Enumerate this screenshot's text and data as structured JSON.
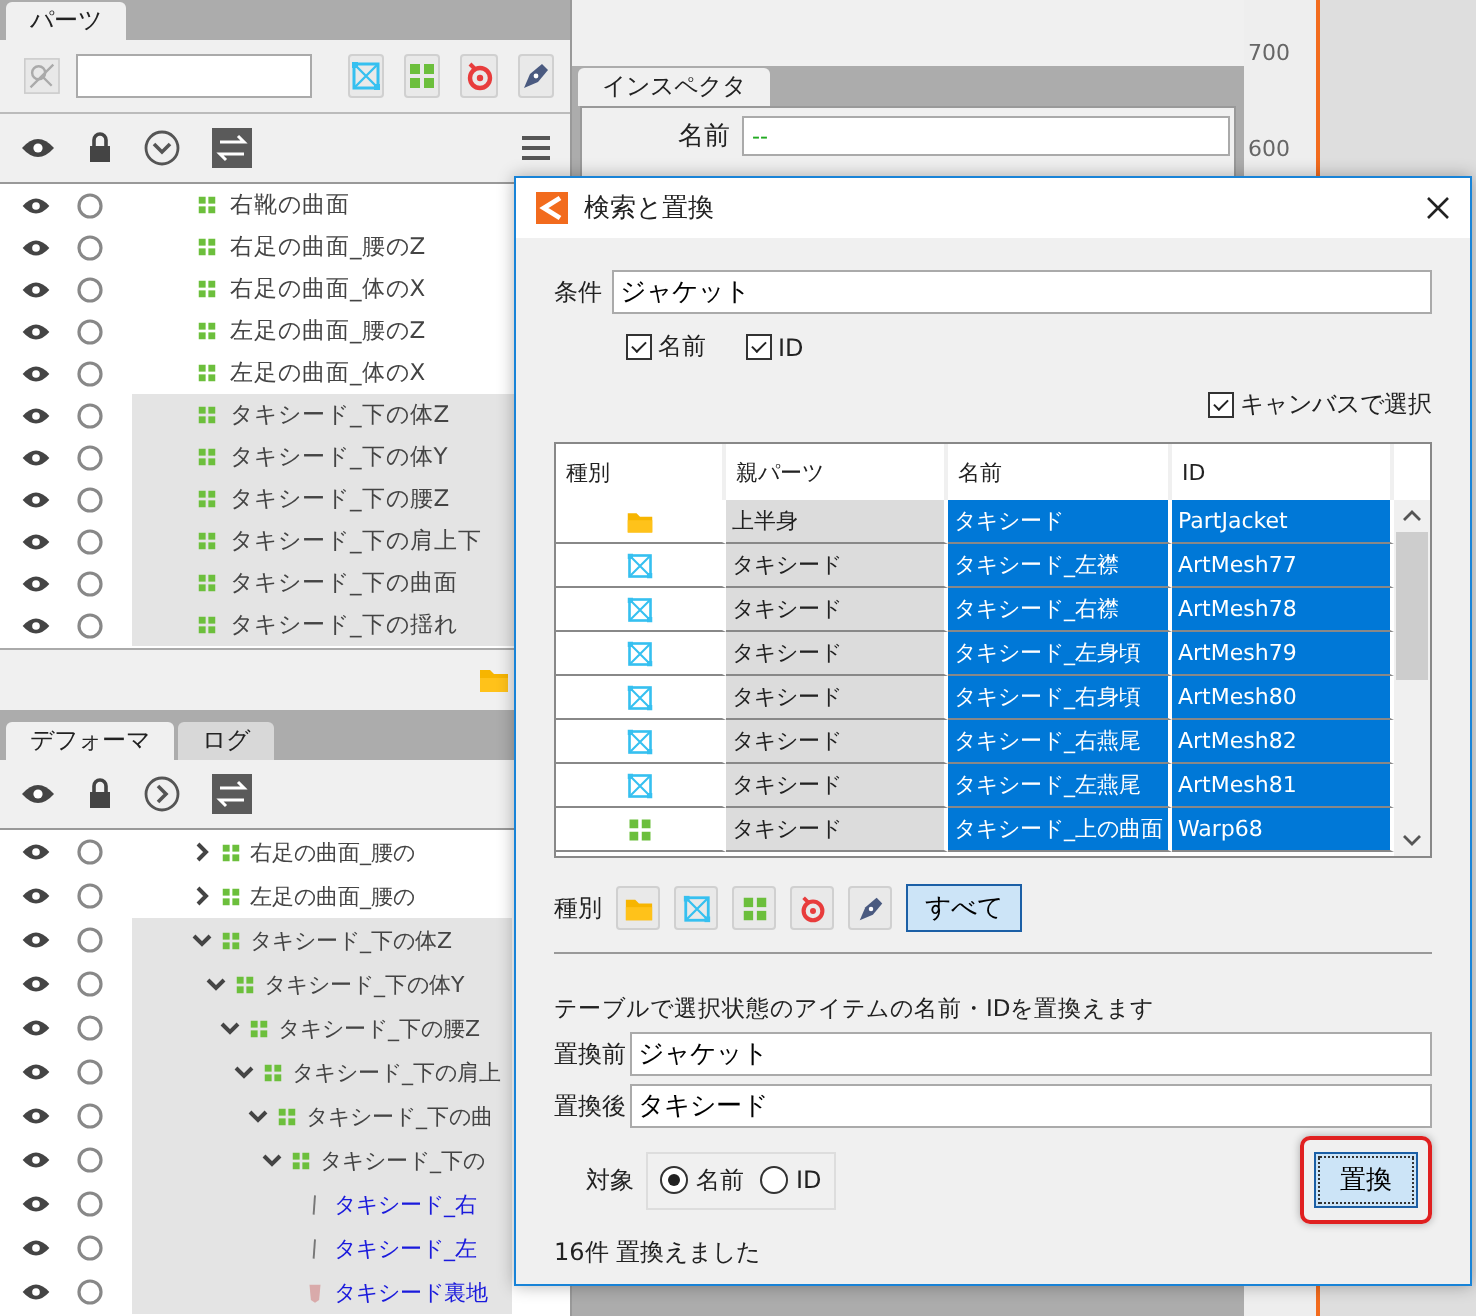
{
  "parts_panel": {
    "tab": "パーツ",
    "items": [
      {
        "name": "右靴の曲面",
        "kind": "warp",
        "selected": false
      },
      {
        "name": "右足の曲面_腰のZ",
        "kind": "warp",
        "selected": false
      },
      {
        "name": "右足の曲面_体のX",
        "kind": "warp",
        "selected": false
      },
      {
        "name": "左足の曲面_腰のZ",
        "kind": "warp",
        "selected": false
      },
      {
        "name": "左足の曲面_体のX",
        "kind": "warp",
        "selected": false
      },
      {
        "name": "タキシード_下の体Z",
        "kind": "warp",
        "selected": true
      },
      {
        "name": "タキシード_下の体Y",
        "kind": "warp",
        "selected": true
      },
      {
        "name": "タキシード_下の腰Z",
        "kind": "warp",
        "selected": true
      },
      {
        "name": "タキシード_下の肩上下",
        "kind": "warp",
        "selected": true
      },
      {
        "name": "タキシード_下の曲面",
        "kind": "warp",
        "selected": true
      },
      {
        "name": "タキシード_下の揺れ",
        "kind": "warp",
        "selected": true
      }
    ]
  },
  "deformer_panel": {
    "tabs": [
      {
        "label": "デフォーマ",
        "selected": true
      },
      {
        "label": "ログ",
        "selected": false
      }
    ],
    "tree": [
      {
        "name": "右足の曲面_腰の",
        "kind": "warp",
        "expanded": false,
        "selected": false
      },
      {
        "name": "左足の曲面_腰の",
        "kind": "warp",
        "expanded": false,
        "selected": false
      },
      {
        "name": "タキシード_下の体Z",
        "kind": "warp",
        "expanded": true,
        "selected": true,
        "children": [
          {
            "name": "タキシード_下の体Y",
            "kind": "warp",
            "expanded": true,
            "selected": true,
            "children": [
              {
                "name": "タキシード_下の腰Z",
                "kind": "warp",
                "expanded": true,
                "selected": true,
                "children": [
                  {
                    "name": "タキシード_下の肩上",
                    "kind": "warp",
                    "expanded": true,
                    "selected": true,
                    "children": [
                      {
                        "name": "タキシード_下の曲",
                        "kind": "warp",
                        "expanded": true,
                        "selected": true,
                        "children": [
                          {
                            "name": "タキシード_下の",
                            "kind": "warp",
                            "expanded": true,
                            "selected": true,
                            "children": [
                              {
                                "name": "タキシード_右",
                                "kind": "strip",
                                "selected": true
                              },
                              {
                                "name": "タキシード_左",
                                "kind": "strip",
                                "selected": true
                              },
                              {
                                "name": "タキシード裏地",
                                "kind": "cloth",
                                "selected": true
                              }
                            ]
                          }
                        ]
                      }
                    ]
                  }
                ]
              }
            ]
          }
        ]
      }
    ]
  },
  "inspector": {
    "tab": "インスペクタ",
    "name_label": "名前",
    "name_value": "--"
  },
  "ruler": {
    "labels": [
      "700",
      "600"
    ]
  },
  "dialog": {
    "title": "検索と置換",
    "condition_label": "条件",
    "condition_value": "ジャケット",
    "match_options": [
      {
        "label": "名前",
        "checked": true
      },
      {
        "label": "ID",
        "checked": true
      }
    ],
    "canvas_select": {
      "label": "キャンバスで選択",
      "checked": true
    },
    "table": {
      "columns": [
        "種別",
        "親パーツ",
        "名前",
        "ID"
      ],
      "rows": [
        {
          "kind": "part",
          "parent": "上半身",
          "name": "タキシード",
          "id": "PartJacket",
          "selected": true
        },
        {
          "kind": "mesh",
          "parent": "タキシード",
          "name": "タキシード_左襟",
          "id": "ArtMesh77",
          "selected": true
        },
        {
          "kind": "mesh",
          "parent": "タキシード",
          "name": "タキシード_右襟",
          "id": "ArtMesh78",
          "selected": true
        },
        {
          "kind": "mesh",
          "parent": "タキシード",
          "name": "タキシード_左身頃",
          "id": "ArtMesh79",
          "selected": true
        },
        {
          "kind": "mesh",
          "parent": "タキシード",
          "name": "タキシード_右身頃",
          "id": "ArtMesh80",
          "selected": true
        },
        {
          "kind": "mesh",
          "parent": "タキシード",
          "name": "タキシード_右燕尾",
          "id": "ArtMesh82",
          "selected": true
        },
        {
          "kind": "mesh",
          "parent": "タキシード",
          "name": "タキシード_左燕尾",
          "id": "ArtMesh81",
          "selected": true
        },
        {
          "kind": "warp",
          "parent": "タキシード",
          "name": "タキシード_上の曲面",
          "id": "Warp68",
          "selected": true
        }
      ]
    },
    "type_filter": {
      "label": "種別",
      "all_button": "すべて"
    },
    "description": "テーブルで選択状態のアイテムの名前・IDを置換えます",
    "before_label": "置換前",
    "before_value": "ジャケット",
    "after_label": "置換後",
    "after_value": "タキシード",
    "target_label": "対象",
    "target_options": [
      {
        "label": "名前",
        "selected": true
      },
      {
        "label": "ID",
        "selected": false
      }
    ],
    "replace_button": "置換",
    "status": "16件 置換えました"
  }
}
